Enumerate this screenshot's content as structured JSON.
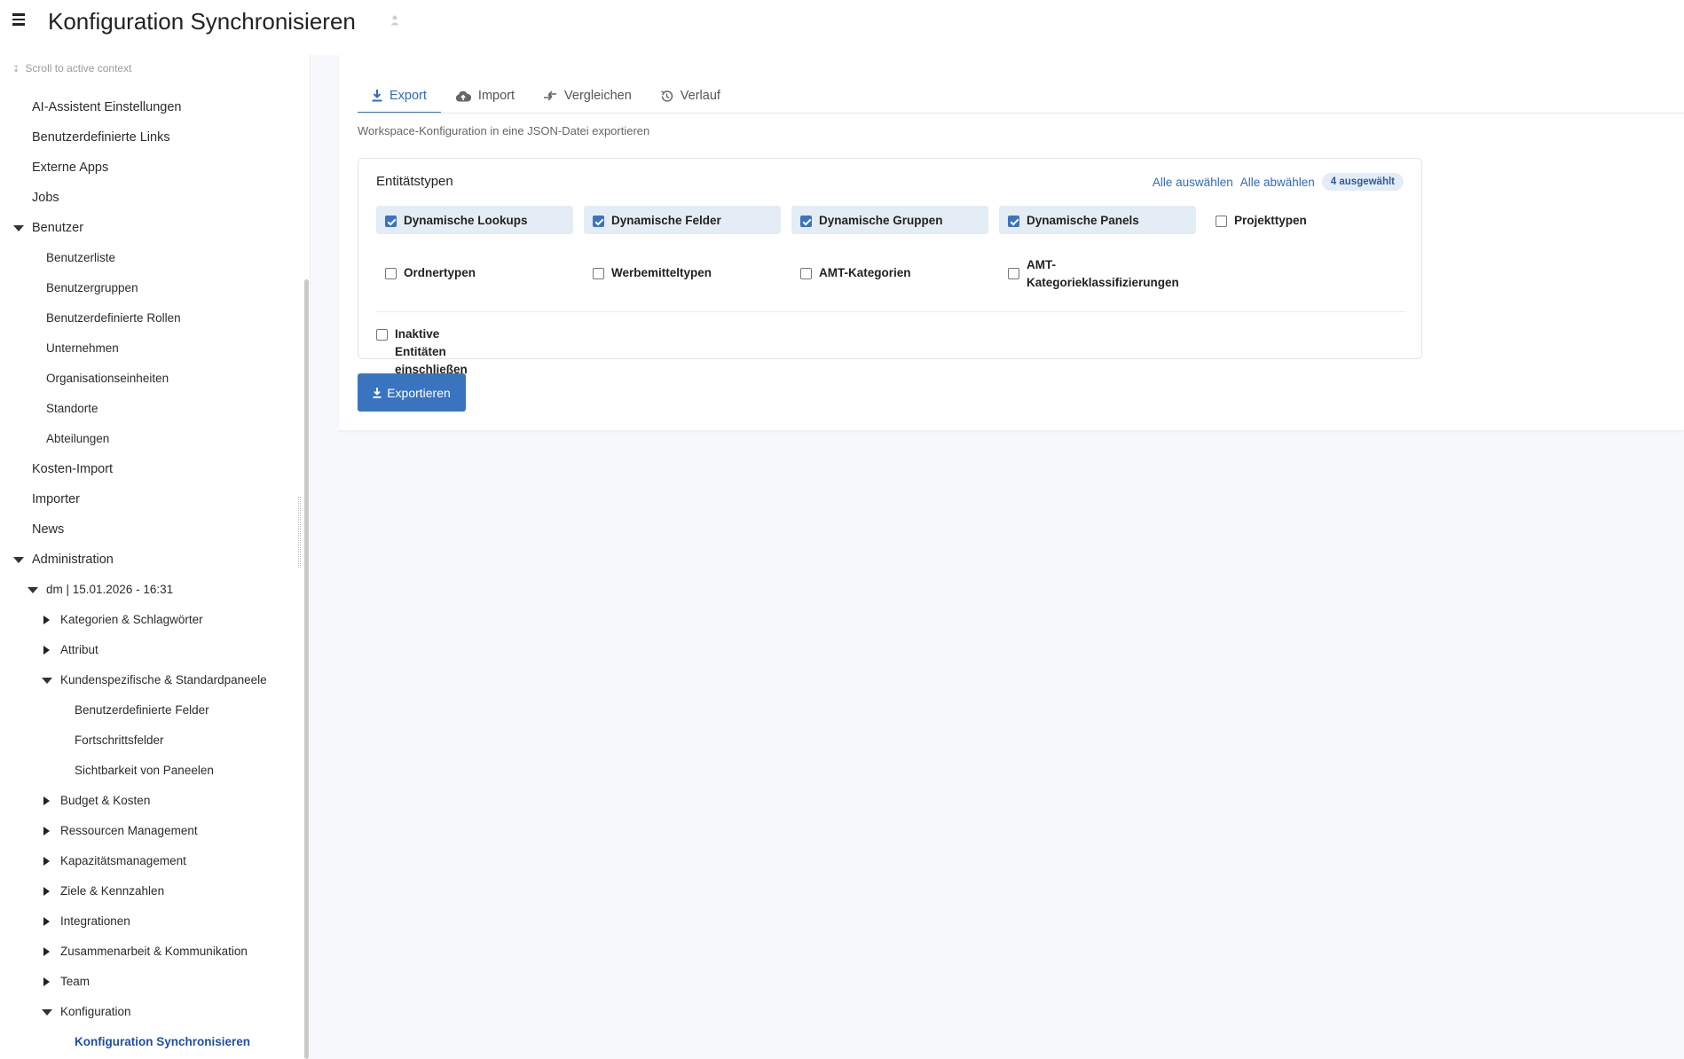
{
  "header": {
    "title": "Konfiguration Synchronisieren"
  },
  "sidebar": {
    "scroll_context": "Scroll to active context",
    "items": [
      {
        "label": "AI-Assistent Einstellungen",
        "level": 0,
        "caret": "none"
      },
      {
        "label": "Benutzerdefinierte Links",
        "level": 0,
        "caret": "none"
      },
      {
        "label": "Externe Apps",
        "level": 0,
        "caret": "none"
      },
      {
        "label": "Jobs",
        "level": 0,
        "caret": "none"
      },
      {
        "label": "Benutzer",
        "level": 0,
        "caret": "down"
      },
      {
        "label": "Benutzerliste",
        "level": 1,
        "caret": "none"
      },
      {
        "label": "Benutzergruppen",
        "level": 1,
        "caret": "none"
      },
      {
        "label": "Benutzerdefinierte Rollen",
        "level": 1,
        "caret": "none"
      },
      {
        "label": "Unternehmen",
        "level": 1,
        "caret": "none"
      },
      {
        "label": "Organisationseinheiten",
        "level": 1,
        "caret": "none"
      },
      {
        "label": "Standorte",
        "level": 1,
        "caret": "none"
      },
      {
        "label": "Abteilungen",
        "level": 1,
        "caret": "none"
      },
      {
        "label": "Kosten-Import",
        "level": 0,
        "caret": "none"
      },
      {
        "label": "Importer",
        "level": 0,
        "caret": "none"
      },
      {
        "label": "News",
        "level": 0,
        "caret": "none"
      },
      {
        "label": "Administration",
        "level": 0,
        "caret": "down"
      },
      {
        "label": "dm | 15.01.2026 - 16:31",
        "level": 1,
        "caret": "down"
      },
      {
        "label": "Kategorien & Schlagwörter",
        "level": 2,
        "caret": "right"
      },
      {
        "label": "Attribut",
        "level": 2,
        "caret": "right"
      },
      {
        "label": "Kundenspezifische & Standardpaneele",
        "level": 2,
        "caret": "down"
      },
      {
        "label": "Benutzerdefinierte Felder",
        "level": 3,
        "caret": "none"
      },
      {
        "label": "Fortschrittsfelder",
        "level": 3,
        "caret": "none"
      },
      {
        "label": "Sichtbarkeit von Paneelen",
        "level": 3,
        "caret": "none"
      },
      {
        "label": "Budget & Kosten",
        "level": 2,
        "caret": "right"
      },
      {
        "label": "Ressourcen Management",
        "level": 2,
        "caret": "right"
      },
      {
        "label": "Kapazitätsmanagement",
        "level": 2,
        "caret": "right"
      },
      {
        "label": "Ziele & Kennzahlen",
        "level": 2,
        "caret": "right"
      },
      {
        "label": "Integrationen",
        "level": 2,
        "caret": "right"
      },
      {
        "label": "Zusammenarbeit & Kommunikation",
        "level": 2,
        "caret": "right"
      },
      {
        "label": "Team",
        "level": 2,
        "caret": "right"
      },
      {
        "label": "Konfiguration",
        "level": 2,
        "caret": "down"
      },
      {
        "label": "Konfiguration Synchronisieren",
        "level": 3,
        "caret": "none",
        "active": true
      }
    ]
  },
  "tabs": [
    {
      "label": "Export",
      "icon": "download-icon",
      "active": true
    },
    {
      "label": "Import",
      "icon": "cloud-upload-icon",
      "active": false
    },
    {
      "label": "Vergleichen",
      "icon": "compare-arrows-icon",
      "active": false
    },
    {
      "label": "Verlauf",
      "icon": "history-icon",
      "active": false
    }
  ],
  "main": {
    "subtitle": "Workspace-Konfiguration in eine JSON-Datei exportieren",
    "card": {
      "title": "Entitätstypen",
      "select_all": "Alle auswählen",
      "deselect_all": "Alle abwählen",
      "selected_badge": "4 ausgewählt",
      "entities": [
        {
          "label": "Dynamische Lookups",
          "checked": true
        },
        {
          "label": "Dynamische Felder",
          "checked": true
        },
        {
          "label": "Dynamische Gruppen",
          "checked": true
        },
        {
          "label": "Dynamische Panels",
          "checked": true
        },
        {
          "label": "Projekttypen",
          "checked": false
        },
        {
          "label": "Ordnertypen",
          "checked": false
        },
        {
          "label": "Werbemitteltypen",
          "checked": false
        },
        {
          "label": "AMT-Kategorien",
          "checked": false
        },
        {
          "label": "AMT-Kategorieklassifizierungen",
          "checked": false
        }
      ],
      "include_inactive": {
        "label": "Inaktive Entitäten einschließen",
        "checked": false
      }
    },
    "export_button": "Exportieren"
  },
  "colors": {
    "accent": "#3a74bf",
    "accent_light": "#e4ecf6",
    "link": "#2f6bb8",
    "active_nav": "#1f4fa3"
  }
}
